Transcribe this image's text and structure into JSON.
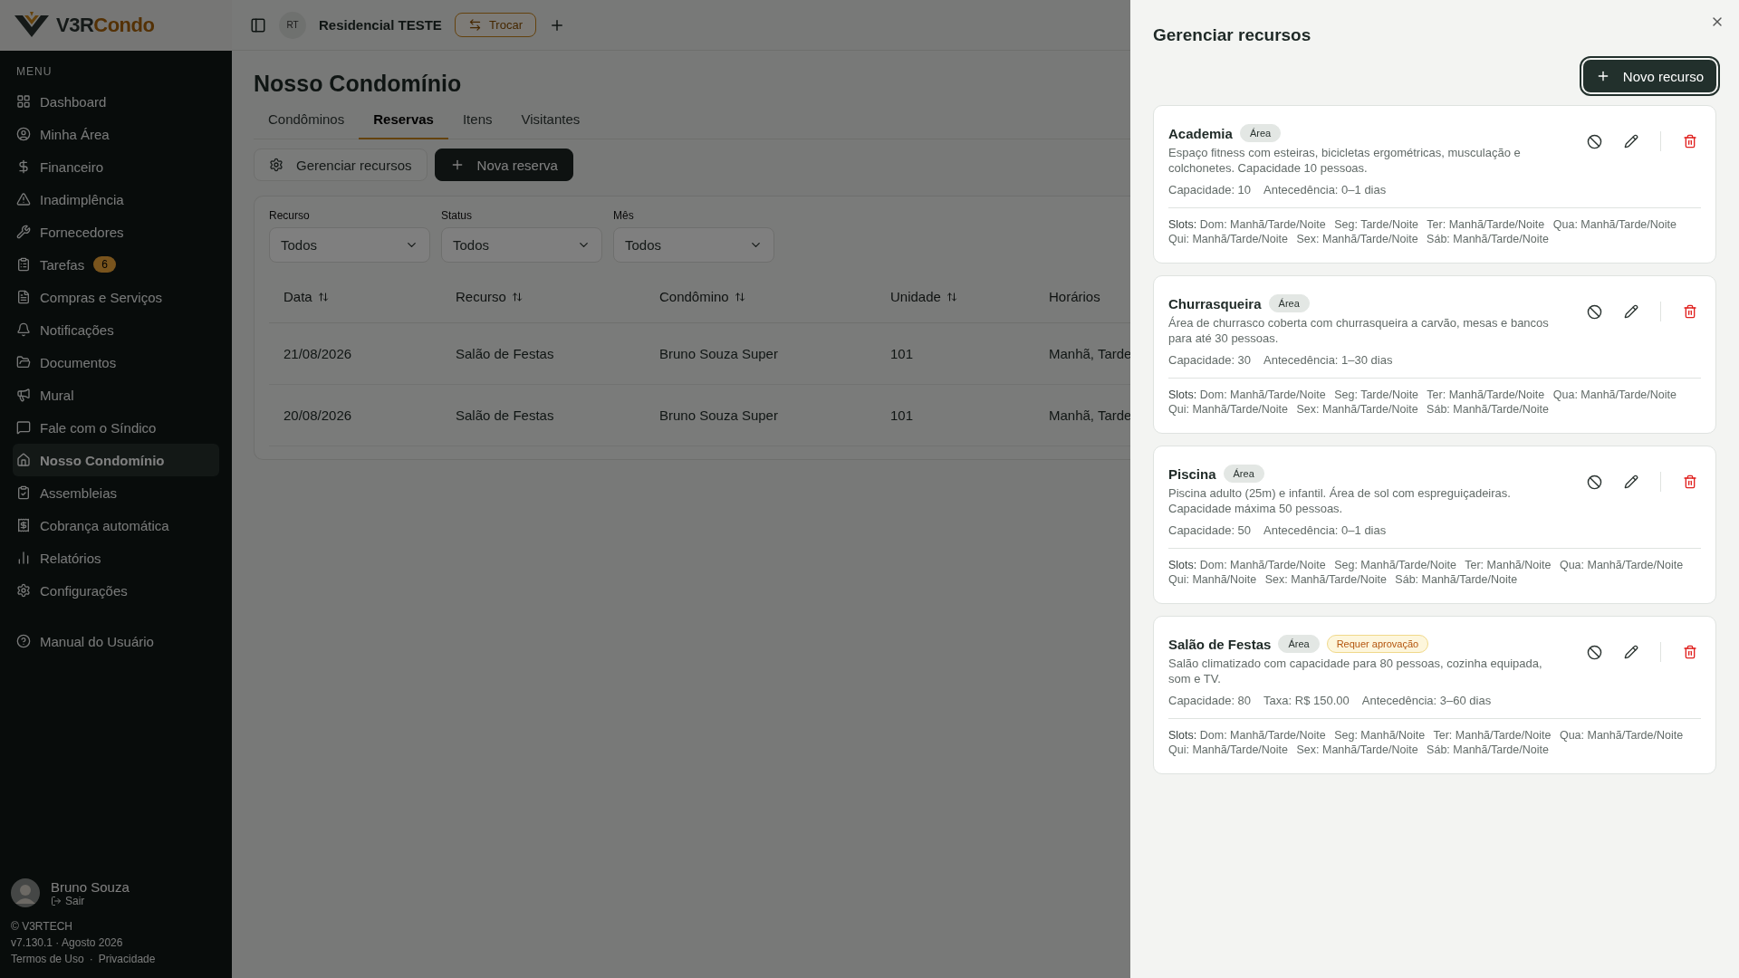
{
  "app": {
    "logo_primary": "V3R",
    "logo_secondary": "Condo"
  },
  "topbar": {
    "avatar": "RT",
    "condo_name": "Residencial TESTE",
    "switch_button": "Trocar"
  },
  "sidebar": {
    "section_label": "MENU",
    "items": [
      {
        "label": "Dashboard",
        "selected": false
      },
      {
        "label": "Minha Área",
        "selected": false
      },
      {
        "label": "Financeiro",
        "selected": false
      },
      {
        "label": "Inadimplência",
        "selected": false
      },
      {
        "label": "Fornecedores",
        "selected": false
      },
      {
        "label": "Tarefas",
        "selected": false,
        "badge": "6"
      },
      {
        "label": "Compras e Serviços",
        "selected": false
      },
      {
        "label": "Notificações",
        "selected": false
      },
      {
        "label": "Documentos",
        "selected": false
      },
      {
        "label": "Mural",
        "selected": false
      },
      {
        "label": "Fale com o Síndico",
        "selected": false
      },
      {
        "label": "Nosso Condomínio",
        "selected": true
      },
      {
        "label": "Assembleias",
        "selected": false
      },
      {
        "label": "Cobrança automática",
        "selected": false
      },
      {
        "label": "Relatórios",
        "selected": false
      },
      {
        "label": "Configurações",
        "selected": false
      }
    ],
    "help_item": "Manual do Usuário",
    "user": {
      "name": "Bruno Souza",
      "logout": "Sair"
    },
    "footer": {
      "copyright": "© V3RTECH",
      "version": "v7.130.1 · Agosto 2026",
      "links": [
        "Termos de Uso",
        "Privacidade"
      ],
      "separator": "·"
    }
  },
  "page": {
    "title": "Nosso Condomínio",
    "tabs": [
      {
        "label": "Condôminos",
        "selected": false
      },
      {
        "label": "Reservas",
        "selected": true
      },
      {
        "label": "Itens",
        "selected": false
      },
      {
        "label": "Visitantes",
        "selected": false
      }
    ],
    "actions": [
      {
        "label": "Gerenciar recursos",
        "kind": "secondary"
      },
      {
        "label": "Nova reserva",
        "kind": "primary"
      }
    ],
    "filters": [
      {
        "label": "Recurso",
        "value": "Todos"
      },
      {
        "label": "Status",
        "value": "Todos"
      },
      {
        "label": "Mês",
        "value": "Todos"
      }
    ],
    "table": {
      "columns": [
        {
          "label": "Data",
          "sortable": true
        },
        {
          "label": "Recurso",
          "sortable": true
        },
        {
          "label": "Condômino",
          "sortable": true
        },
        {
          "label": "Unidade",
          "sortable": true
        },
        {
          "label": "Horários",
          "sortable": false
        }
      ],
      "rows": [
        [
          "21/08/2026",
          "Salão de Festas",
          "Bruno Souza Super",
          "101",
          "Manhã, Tarde"
        ],
        [
          "20/08/2026",
          "Salão de Festas",
          "Bruno Souza Super",
          "101",
          "Manhã, Tarde"
        ]
      ]
    }
  },
  "dialog": {
    "title": "Gerenciar recursos",
    "new_button": "Novo recurso",
    "resources": [
      {
        "name": "Academia",
        "tags": [
          {
            "label": "Área",
            "kind": "type"
          }
        ],
        "description": "Espaço fitness com esteiras, bicicletas ergométricas, musculação e colchonetes. Capacidade 10 pessoas.",
        "details": [
          "Capacidade: 10",
          "Antecedência: 0–1 dias"
        ],
        "slots_label": "Slots:",
        "slots": [
          "Dom: Manhã/Tarde/Noite",
          "Seg: Tarde/Noite",
          "Ter: Manhã/Tarde/Noite",
          "Qua: Manhã/Tarde/Noite",
          "Qui: Manhã/Tarde/Noite",
          "Sex: Manhã/Tarde/Noite",
          "Sáb: Manhã/Tarde/Noite"
        ]
      },
      {
        "name": "Churrasqueira",
        "tags": [
          {
            "label": "Área",
            "kind": "type"
          }
        ],
        "description": "Área de churrasco coberta com churrasqueira a carvão, mesas e bancos para até 30 pessoas.",
        "details": [
          "Capacidade: 30",
          "Antecedência: 1–30 dias"
        ],
        "slots_label": "Slots:",
        "slots": [
          "Dom: Manhã/Tarde/Noite",
          "Seg: Tarde/Noite",
          "Ter: Manhã/Tarde/Noite",
          "Qua: Manhã/Tarde/Noite",
          "Qui: Manhã/Tarde/Noite",
          "Sex: Manhã/Tarde/Noite",
          "Sáb: Manhã/Tarde/Noite"
        ]
      },
      {
        "name": "Piscina",
        "tags": [
          {
            "label": "Área",
            "kind": "type"
          }
        ],
        "description": "Piscina adulto (25m) e infantil. Área de sol com espreguiçadeiras. Capacidade máxima 50 pessoas.",
        "details": [
          "Capacidade: 50",
          "Antecedência: 0–1 dias"
        ],
        "slots_label": "Slots:",
        "slots": [
          "Dom: Manhã/Tarde/Noite",
          "Seg: Manhã/Tarde/Noite",
          "Ter: Manhã/Noite",
          "Qua: Manhã/Tarde/Noite",
          "Qui: Manhã/Noite",
          "Sex: Manhã/Tarde/Noite",
          "Sáb: Manhã/Tarde/Noite"
        ]
      },
      {
        "name": "Salão de Festas",
        "tags": [
          {
            "label": "Área",
            "kind": "type"
          },
          {
            "label": "Requer aprovação",
            "kind": "warning"
          }
        ],
        "description": "Salão climatizado com capacidade para 80 pessoas, cozinha equipada, som e TV.",
        "details": [
          "Capacidade: 80",
          "Taxa: R$ 150.00",
          "Antecedência: 3–60 dias"
        ],
        "slots_label": "Slots:",
        "slots": [
          "Dom: Manhã/Tarde/Noite",
          "Seg: Manhã/Noite",
          "Ter: Manhã/Tarde/Noite",
          "Qua: Manhã/Tarde/Noite",
          "Qui: Manhã/Tarde/Noite",
          "Sex: Manhã/Tarde/Noite",
          "Sáb: Manhã/Tarde/Noite"
        ]
      }
    ]
  }
}
